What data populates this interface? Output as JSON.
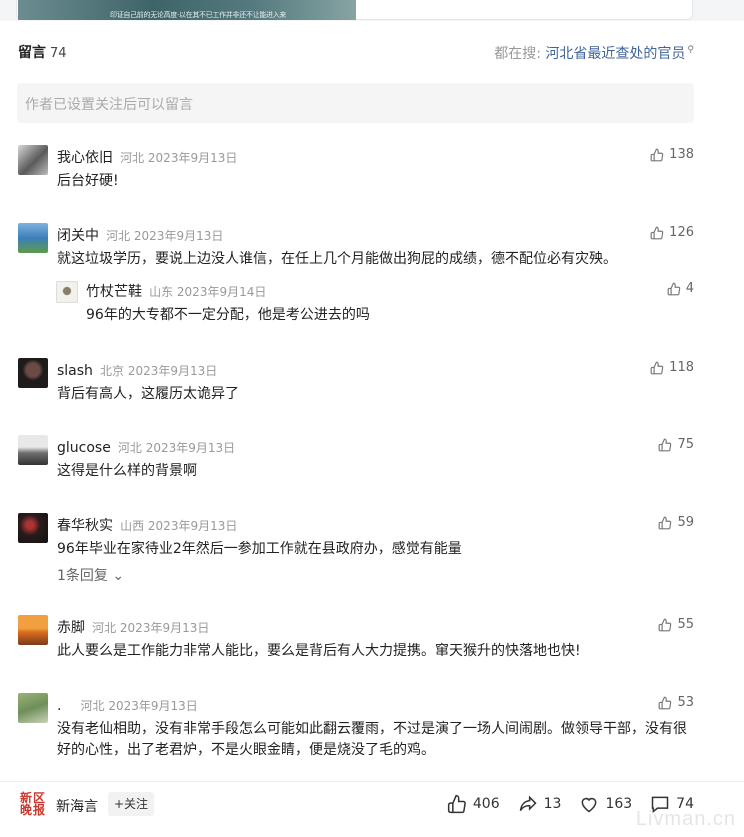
{
  "top": {
    "banner_text": "印证自己前的无论高度·以在其不已工作并非还不让能进入来"
  },
  "header": {
    "title": "留言",
    "count": "74",
    "hot_prefix": "都在搜:",
    "hot_query": "河北省最近查处的官员"
  },
  "reply_box": {
    "placeholder": "作者已设置关注后可以留言"
  },
  "comments": [
    {
      "name": "我心依旧",
      "loc_date": "河北 2023年9月13日",
      "likes": "138",
      "text": "后台好硬!"
    },
    {
      "name": "闭关中",
      "loc_date": "河北 2023年9月13日",
      "likes": "126",
      "text": "就这垃圾学历，要说上边没人谁信，在任上几个月能做出狗屁的成绩，德不配位必有灾殃。",
      "reply": {
        "name": "竹杖芒鞋",
        "loc_date": "山东 2023年9月14日",
        "likes": "4",
        "text": "96年的大专都不一定分配，他是考公进去的吗"
      }
    },
    {
      "name": "slash",
      "loc_date": "北京 2023年9月13日",
      "likes": "118",
      "text": "背后有高人，这履历太诡异了"
    },
    {
      "name": "glucose",
      "loc_date": "河北 2023年9月13日",
      "likes": "75",
      "text": "这得是什么样的背景啊"
    },
    {
      "name": "春华秋实",
      "loc_date": "山西 2023年9月13日",
      "likes": "59",
      "text": "96年毕业在家待业2年然后一参加工作就在县政府办，感觉有能量",
      "more": "1条回复"
    },
    {
      "name": "赤脚",
      "loc_date": "河北 2023年9月13日",
      "likes": "55",
      "text": "此人要么是工作能力非常人能比，要么是背后有人大力提携。窜天猴升的快落地也快!"
    },
    {
      "name": ".",
      "loc_date": "河北 2023年9月13日",
      "likes": "53",
      "text": "没有老仙相助，没有非常手段怎么可能如此翻云覆雨，不过是演了一场人间闹剧。做领导干部，没有很好的心性，出了老君炉，不是火眼金睛，便是烧没了毛的鸡。"
    }
  ],
  "bottom": {
    "logo_text": "新区晚报",
    "account_name": "新海言",
    "follow_label": "+关注",
    "likes": "406",
    "shares": "13",
    "favorites": "163",
    "comments": "74",
    "watermark": "Livman.cn"
  },
  "colors": {
    "link": "#406599",
    "muted": "#999999",
    "brand_red": "#c83a2e"
  }
}
